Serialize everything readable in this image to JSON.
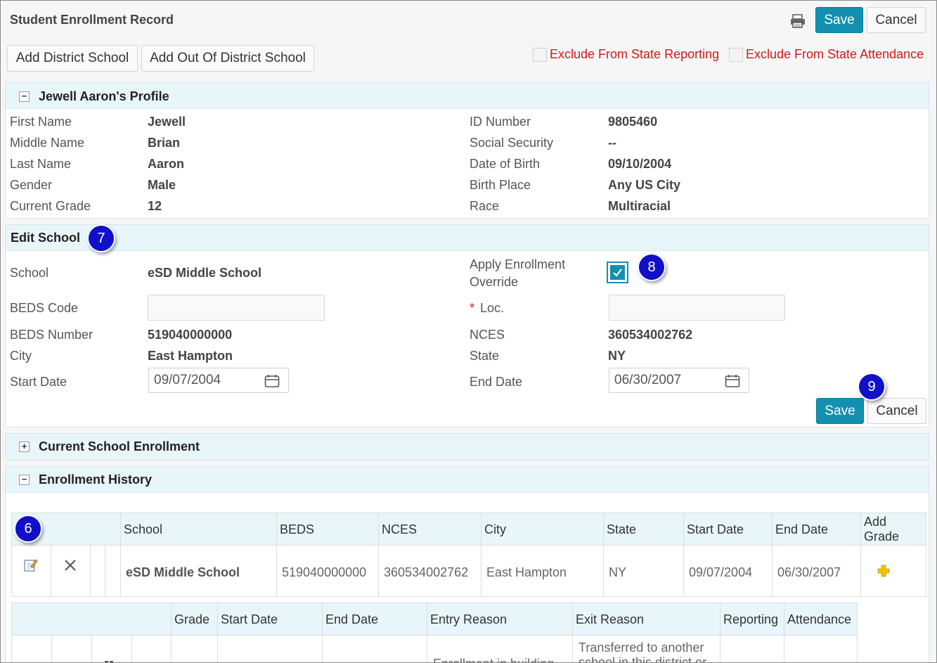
{
  "header": {
    "title": "Student Enrollment Record",
    "save_label": "Save",
    "cancel_label": "Cancel"
  },
  "toolbar": {
    "add_district_school": "Add District School",
    "add_out_of_district_school": "Add Out Of District School",
    "exclude_state_reporting": "Exclude From State Reporting",
    "exclude_state_attendance": "Exclude From State Attendance"
  },
  "profile": {
    "title": "Jewell Aaron's Profile",
    "toggle": "−",
    "left": [
      {
        "label": "First Name",
        "value": "Jewell"
      },
      {
        "label": "Middle Name",
        "value": "Brian"
      },
      {
        "label": "Last Name",
        "value": "Aaron"
      },
      {
        "label": "Gender",
        "value": "Male"
      },
      {
        "label": "Current Grade",
        "value": "12"
      }
    ],
    "right": [
      {
        "label": "ID Number",
        "value": "9805460"
      },
      {
        "label": "Social Security",
        "value": "--"
      },
      {
        "label": "Date of Birth",
        "value": "09/10/2004"
      },
      {
        "label": "Birth Place",
        "value": "Any US City"
      },
      {
        "label": "Race",
        "value": "Multiracial"
      }
    ]
  },
  "edit_school": {
    "title": "Edit School",
    "school_label": "School",
    "school_value": "eSD Middle School",
    "apply_override_label_1": "Apply Enrollment",
    "apply_override_label_2": "Override",
    "apply_override_checked": true,
    "beds_code_label": "BEDS Code",
    "beds_code_value": "",
    "loc_required": "*",
    "loc_label": "Loc.",
    "loc_value": "",
    "beds_number_label": "BEDS Number",
    "beds_number_value": "519040000000",
    "nces_label": "NCES",
    "nces_value": "360534002762",
    "city_label": "City",
    "city_value": "East Hampton",
    "state_label": "State",
    "state_value": "NY",
    "start_date_label": "Start Date",
    "start_date_value": "09/07/2004",
    "end_date_label": "End Date",
    "end_date_value": "06/30/2007",
    "save_label": "Save",
    "cancel_label": "Cancel"
  },
  "current_enrollment": {
    "title": "Current School Enrollment",
    "toggle": "+"
  },
  "history": {
    "title": "Enrollment History",
    "toggle": "−",
    "columns": [
      "School",
      "BEDS",
      "NCES",
      "City",
      "State",
      "Start Date",
      "End Date"
    ],
    "add_grade_1": "Add",
    "add_grade_2": "Grade",
    "row": {
      "school": "eSD Middle School",
      "beds": "519040000000",
      "nces": "360534002762",
      "city": "East Hampton",
      "state": "NY",
      "start_date": "09/07/2004",
      "end_date": "06/30/2007"
    },
    "grade_columns": [
      "Grade",
      "Start Date",
      "End Date",
      "Entry Reason",
      "Exit Reason",
      "Reporting",
      "Attendance"
    ],
    "grade_row": {
      "entry_reason": "Enrollment in building",
      "exit_reason_1": "Transferred to another",
      "exit_reason_2": "school in this district or"
    }
  },
  "callouts": [
    "6",
    "7",
    "8",
    "9"
  ],
  "colors": {
    "primary_button": "#1390b0",
    "panel_header": "#e8f6fa",
    "exclude_text": "#d11a1a",
    "callout": "#1010c8",
    "add_icon": "#f0c000"
  }
}
